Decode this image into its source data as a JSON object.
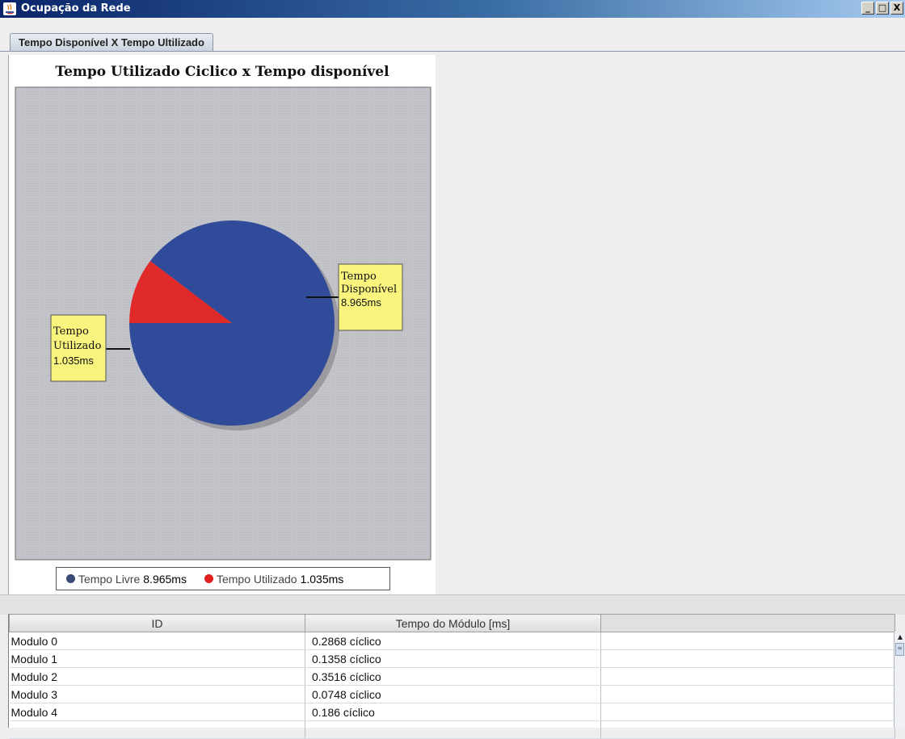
{
  "window": {
    "title": "Ocupação da Rede",
    "minimize": "_",
    "maximize": "□",
    "close": "X"
  },
  "tabs": [
    {
      "label": "Tempo Disponível X Tempo Ultilizado",
      "active": true
    }
  ],
  "chart_data": {
    "type": "pie",
    "title": "Tempo Utilizado Ciclico x Tempo disponível",
    "slices": [
      {
        "name": "Tempo Livre",
        "value": 8.965,
        "unit": "ms",
        "color": "#2f4b9a"
      },
      {
        "name": "Tempo Utilizado",
        "value": 1.035,
        "unit": "ms",
        "color": "#e02a2a"
      }
    ],
    "labels": [
      {
        "line1": "Tempo",
        "line2": "Disponível",
        "value": "8.965ms"
      },
      {
        "line1": "Tempo",
        "line2": "Utilizado",
        "value": "1.035ms"
      }
    ],
    "legend": [
      {
        "label": "Tempo Livre",
        "value": "8.965ms",
        "color": "#3a4b75"
      },
      {
        "label": "Tempo Utilizado",
        "value": "1.035ms",
        "color": "#e02020"
      }
    ],
    "legend_position": "bottom",
    "plot_background": "#c3c4c9"
  },
  "table": {
    "columns": [
      "ID",
      "Tempo do Módulo [ms]",
      ""
    ],
    "rows": [
      [
        "Modulo 0",
        "0.2868 cíclico",
        ""
      ],
      [
        "Modulo 1",
        "0.1358 cíclico",
        ""
      ],
      [
        "Modulo 2",
        "0.3516 cíclico",
        ""
      ],
      [
        "Modulo 3",
        "0.0748 cíclico",
        ""
      ],
      [
        "Modulo 4",
        "0.186 cíclico",
        ""
      ],
      [
        "",
        "",
        ""
      ]
    ]
  },
  "scrollbar": {
    "up_arrow": "▲",
    "thumb_grip": "≡"
  }
}
